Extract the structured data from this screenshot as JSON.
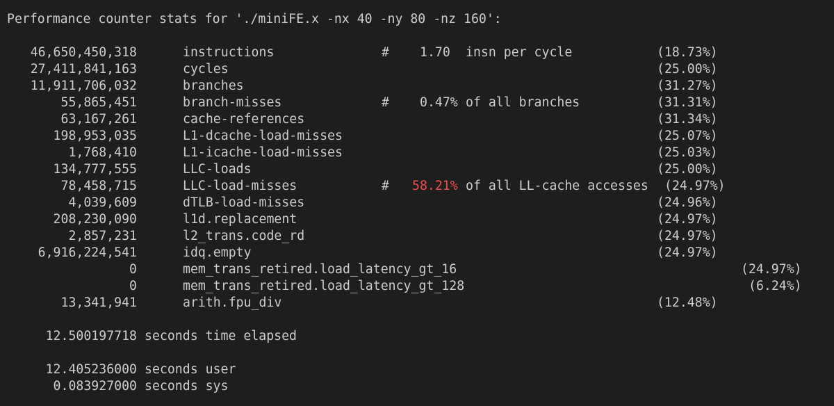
{
  "header": "Performance counter stats for './miniFE.x -nx 40 -ny 80 -nz 160':",
  "rows": [
    {
      "count": "46,650,450,318",
      "event": "instructions",
      "hash": "#",
      "ratio": "1.70",
      "ratio_text": "insn per cycle",
      "pct": "(18.73%)"
    },
    {
      "count": "27,411,841,163",
      "event": "cycles",
      "hash": "",
      "ratio": "",
      "ratio_text": "",
      "pct": "(25.00%)"
    },
    {
      "count": "11,911,706,032",
      "event": "branches",
      "hash": "",
      "ratio": "",
      "ratio_text": "",
      "pct": "(31.27%)"
    },
    {
      "count": "55,865,451",
      "event": "branch-misses",
      "hash": "#",
      "ratio": "0.47%",
      "ratio_text": "of all branches",
      "pct": "(31.31%)"
    },
    {
      "count": "63,167,261",
      "event": "cache-references",
      "hash": "",
      "ratio": "",
      "ratio_text": "",
      "pct": "(31.34%)"
    },
    {
      "count": "198,953,035",
      "event": "L1-dcache-load-misses",
      "hash": "",
      "ratio": "",
      "ratio_text": "",
      "pct": "(25.07%)"
    },
    {
      "count": "1,768,410",
      "event": "L1-icache-load-misses",
      "hash": "",
      "ratio": "",
      "ratio_text": "",
      "pct": "(25.03%)"
    },
    {
      "count": "134,777,555",
      "event": "LLC-loads",
      "hash": "",
      "ratio": "",
      "ratio_text": "",
      "pct": "(25.00%)"
    },
    {
      "count": "78,458,715",
      "event": "LLC-load-misses",
      "hash": "#",
      "ratio": "58.21%",
      "ratio_text": "of all LL-cache accesses",
      "pct": "(24.97%)"
    },
    {
      "count": "4,039,609",
      "event": "dTLB-load-misses",
      "hash": "",
      "ratio": "",
      "ratio_text": "",
      "pct": "(24.96%)"
    },
    {
      "count": "208,230,090",
      "event": "l1d.replacement",
      "hash": "",
      "ratio": "",
      "ratio_text": "",
      "pct": "(24.97%)"
    },
    {
      "count": "2,857,231",
      "event": "l2_trans.code_rd",
      "hash": "",
      "ratio": "",
      "ratio_text": "",
      "pct": "(24.97%)"
    },
    {
      "count": "6,916,224,541",
      "event": "idq.empty",
      "hash": "",
      "ratio": "",
      "ratio_text": "",
      "pct": "(24.97%)"
    },
    {
      "count": "0",
      "event": "mem_trans_retired.load_latency_gt_16",
      "hash": "",
      "ratio": "",
      "ratio_text": "",
      "pct": "(24.97%)"
    },
    {
      "count": "0",
      "event": "mem_trans_retired.load_latency_gt_128",
      "hash": "",
      "ratio": "",
      "ratio_text": "",
      "pct": "(6.24%)"
    },
    {
      "count": "13,341,941",
      "event": "arith.fpu_div",
      "hash": "",
      "ratio": "",
      "ratio_text": "",
      "pct": "(12.48%)"
    }
  ],
  "timing": [
    {
      "value": "12.500197718",
      "label": "seconds time elapsed"
    },
    {
      "value": "12.405236000",
      "label": "seconds user"
    },
    {
      "value": "0.083927000",
      "label": "seconds sys"
    }
  ],
  "colors": {
    "background": "#1e1e1e",
    "foreground": "#cccccc",
    "highlight": "#f14c4c"
  }
}
